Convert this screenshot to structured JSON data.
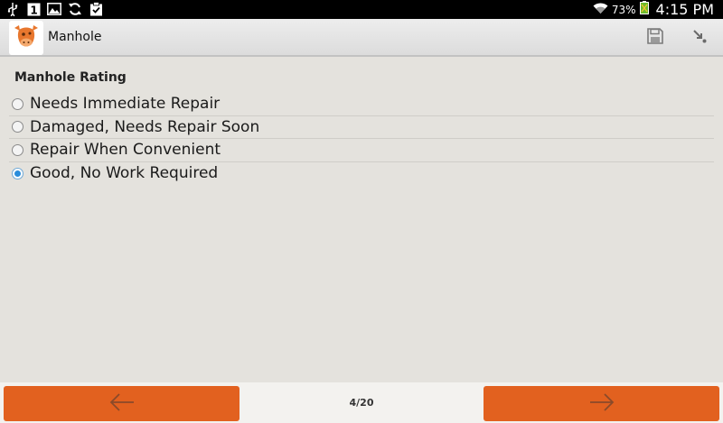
{
  "status_bar": {
    "left_icons": [
      "usb-icon",
      "calendar-icon",
      "image-icon",
      "sync-icon",
      "clipboard-check-icon"
    ],
    "calendar_day": "1",
    "battery_percent": "73%",
    "time": "4:15 PM"
  },
  "action_bar": {
    "title": "Manhole",
    "logo_icon": "cow-logo-icon",
    "actions": [
      "save-icon",
      "go-to-icon"
    ]
  },
  "form": {
    "question": "Manhole Rating",
    "options": [
      {
        "label": "Needs Immediate Repair",
        "selected": false
      },
      {
        "label": "Damaged, Needs Repair Soon",
        "selected": false
      },
      {
        "label": "Repair When Convenient",
        "selected": false
      },
      {
        "label": "Good, No Work Required",
        "selected": true
      }
    ]
  },
  "navigation": {
    "page_indicator": "4/20",
    "prev_icon": "arrow-left-icon",
    "next_icon": "arrow-right-icon"
  },
  "colors": {
    "accent": "#e2611f",
    "background": "#e4e2dd",
    "radio_selected": "#2a8ddb"
  }
}
